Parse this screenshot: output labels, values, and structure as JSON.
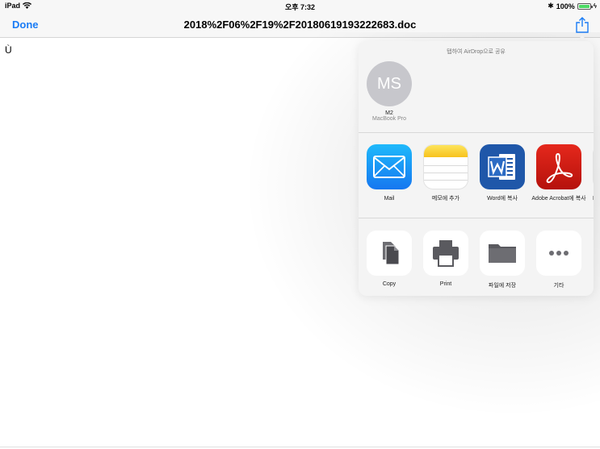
{
  "status_bar": {
    "device": "iPad",
    "time": "오후 7:32",
    "battery": "100%",
    "colors": {
      "battery": "#4cd964"
    }
  },
  "nav": {
    "done_label": "Done",
    "title": "2018%2F06%2F19%2F20180619193222683.doc",
    "accent": "#1a7cf5"
  },
  "document": {
    "text": "Ù"
  },
  "share_sheet": {
    "airdrop_caption": "탭하여 AirDrop으로 공유",
    "airdrop_device": {
      "initials": "MS",
      "name": "M2",
      "model": "MacBook Pro"
    },
    "apps": [
      {
        "label": "Mail",
        "icon": "mail-icon"
      },
      {
        "label": "메모에 추가",
        "icon": "notes-icon"
      },
      {
        "label": "Word에 복사",
        "icon": "word-icon"
      },
      {
        "label": "Adobe Acrobat에 복사",
        "icon": "acrobat-icon"
      },
      {
        "label": "D",
        "icon": "app-icon"
      }
    ],
    "actions": [
      {
        "label": "Copy",
        "icon": "copy-icon"
      },
      {
        "label": "Print",
        "icon": "printer-icon"
      },
      {
        "label": "파일에 저장",
        "icon": "folder-icon"
      },
      {
        "label": "기타",
        "icon": "more-icon"
      }
    ]
  }
}
